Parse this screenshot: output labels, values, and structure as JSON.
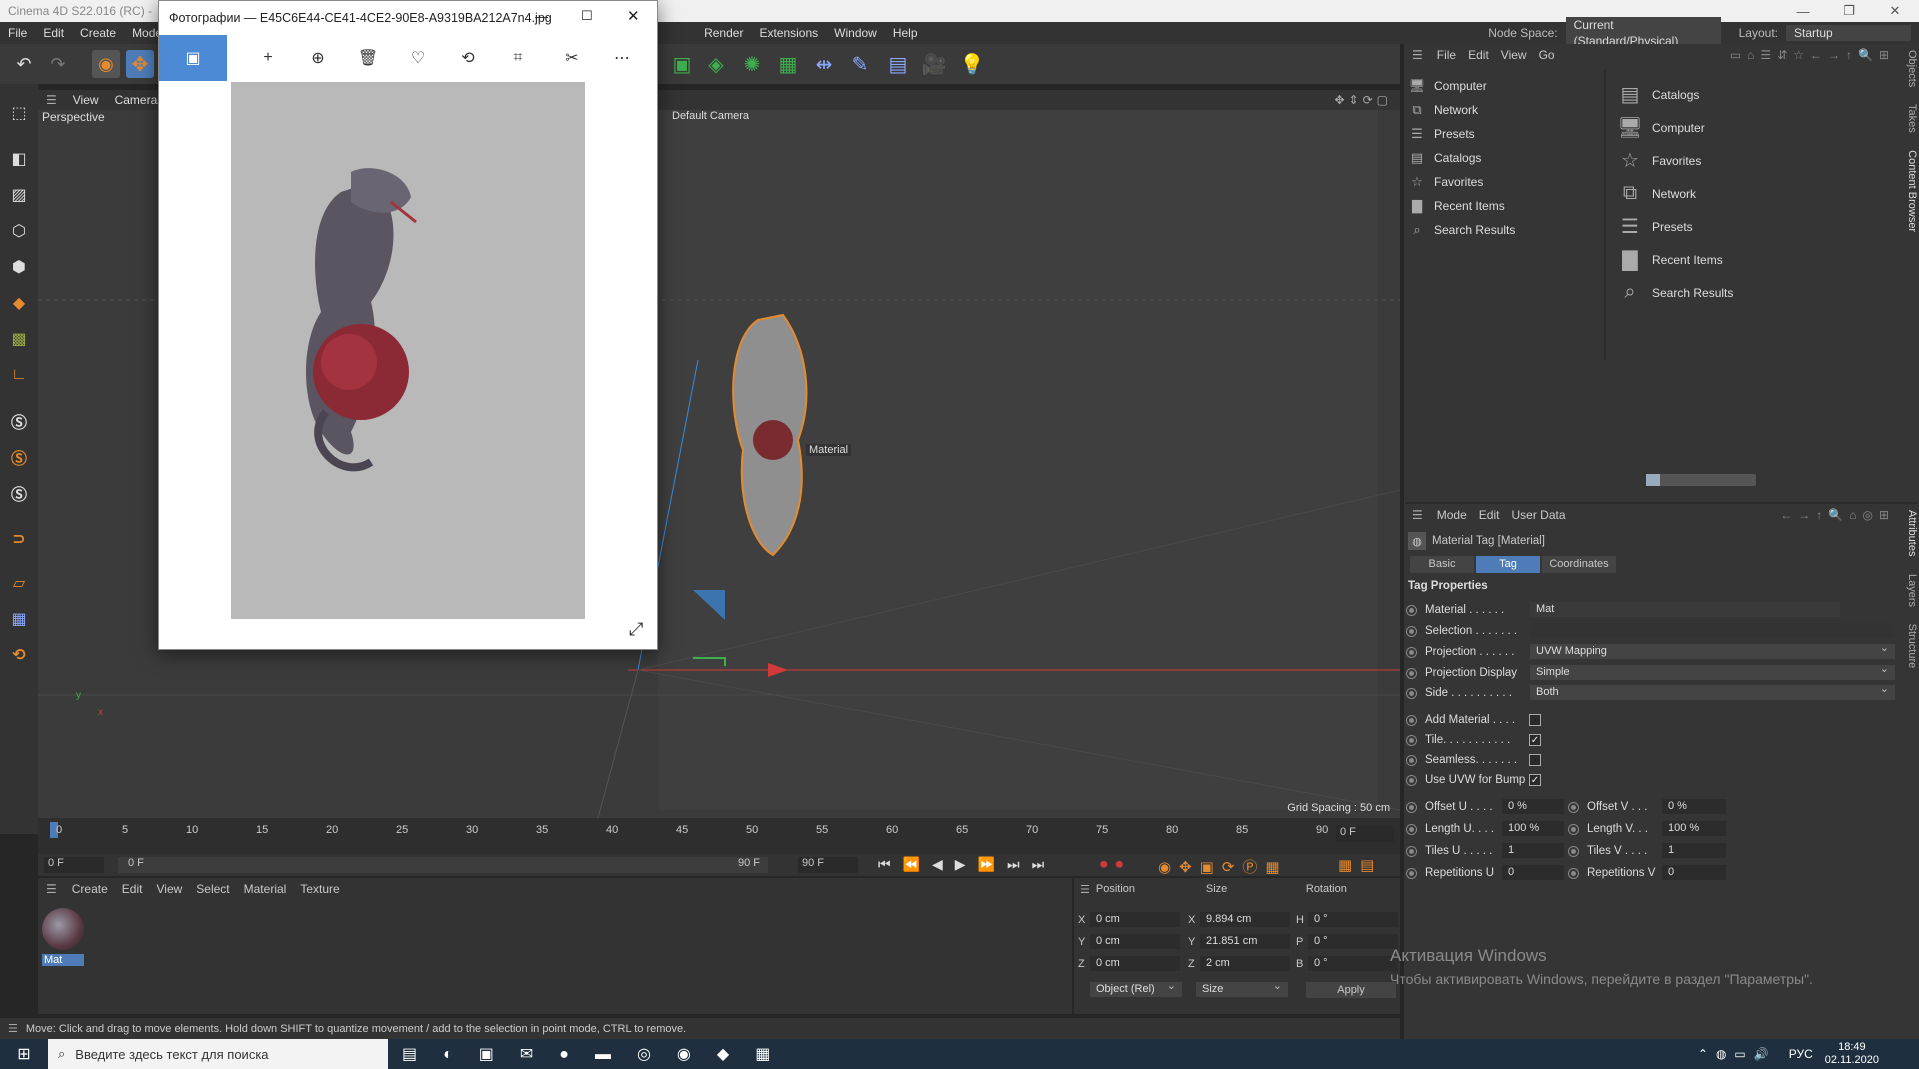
{
  "app": {
    "title": "Cinema 4D S22.016 (RC) -",
    "node_space_label": "Node Space:",
    "node_space_value": "Current (Standard/Physical)",
    "layout_label": "Layout:",
    "layout_value": "Startup"
  },
  "menu": [
    "File",
    "Edit",
    "Create",
    "Modes",
    "Render",
    "Extensions",
    "Window",
    "Help"
  ],
  "viewport": {
    "menu": [
      "View",
      "Cameras"
    ],
    "left_label": "Perspective",
    "camera": "Default Camera",
    "grid_spacing": "Grid Spacing : 50 cm",
    "material_label": "Material"
  },
  "content_browser": {
    "menu": [
      "File",
      "Edit",
      "View",
      "Go"
    ],
    "tree": [
      "Computer",
      "Network",
      "Presets",
      "Catalogs",
      "Favorites",
      "Recent Items",
      "Search Results"
    ],
    "list": [
      "Catalogs",
      "Computer",
      "Favorites",
      "Network",
      "Presets",
      "Recent Items",
      "Search Results"
    ],
    "side_tabs": [
      "Objects",
      "Takes",
      "Content Browser"
    ]
  },
  "attributes": {
    "menu": [
      "Mode",
      "Edit",
      "User Data"
    ],
    "title": "Material Tag [Material]",
    "tabs": [
      "Basic",
      "Tag",
      "Coordinates"
    ],
    "active_tab": "Tag",
    "section": "Tag Properties",
    "material_label": "Material . . . . . .",
    "material_value": "Mat",
    "selection_label": "Selection . . . . . . .",
    "projection_label": "Projection . . . . . .",
    "projection_value": "UVW Mapping",
    "projection_display_label": "Projection Display",
    "projection_display_value": "Simple",
    "side_label": "Side . . . . . . . . . .",
    "side_value": "Both",
    "add_material_label": "Add Material . . . .",
    "tile_label": "Tile. . . . . . . . . . .",
    "seamless_label": "Seamless. . . . . . .",
    "use_uvw_label": "Use UVW for Bump",
    "offset_u_label": "Offset U . . . .",
    "offset_u": "0 %",
    "offset_v_label": "Offset V . . .",
    "offset_v": "0 %",
    "length_u_label": "Length U. . . .",
    "length_u": "100 %",
    "length_v_label": "Length V. . .",
    "length_v": "100 %",
    "tiles_u_label": "Tiles U . . . . .",
    "tiles_u": "1",
    "tiles_v_label": "Tiles V . . . .",
    "tiles_v": "1",
    "rep_u_label": "Repetitions U",
    "rep_u": "0",
    "rep_v_label": "Repetitions V",
    "rep_v": "0",
    "side_tabs": [
      "Attributes",
      "Layers",
      "Structure"
    ]
  },
  "timeline": {
    "ticks": [
      "0",
      "5",
      "10",
      "15",
      "20",
      "25",
      "30",
      "35",
      "40",
      "45",
      "50",
      "55",
      "60",
      "65",
      "70",
      "75",
      "80",
      "85",
      "90"
    ],
    "current": "0 F",
    "start": "0 F",
    "cursor_label": "0 F",
    "end": "90 F",
    "end2": "90 F",
    "right_frame": "0 F"
  },
  "materials": {
    "menu": [
      "Create",
      "Edit",
      "View",
      "Select",
      "Material",
      "Texture"
    ],
    "item": "Mat"
  },
  "coords": {
    "headers": [
      "Position",
      "Size",
      "Rotation"
    ],
    "rows": [
      {
        "axis": "X",
        "pos": "0 cm",
        "size_axis": "X",
        "size": "9.894 cm",
        "rot_axis": "H",
        "rot": "0 °"
      },
      {
        "axis": "Y",
        "pos": "0 cm",
        "size_axis": "Y",
        "size": "21.851 cm",
        "rot_axis": "P",
        "rot": "0 °"
      },
      {
        "axis": "Z",
        "pos": "0 cm",
        "size_axis": "Z",
        "size": "2 cm",
        "rot_axis": "B",
        "rot": "0 °"
      }
    ],
    "mode": "Object (Rel)",
    "size_mode": "Size",
    "apply": "Apply"
  },
  "status": "Move: Click and drag to move elements. Hold down SHIFT to quantize movement / add to the selection in point mode, CTRL to remove.",
  "watermark": {
    "line1": "Активация Windows",
    "line2": "Чтобы активировать Windows, перейдите в раздел \"Параметры\"."
  },
  "taskbar": {
    "search": "Введите здесь текст для поиска",
    "lang": "РУС",
    "time": "18:49",
    "date": "02.11.2020"
  },
  "photos": {
    "title": "Фотографии — E45C6E44-CE41-4CE2-90E8-A9319BA212A7n4.jpg"
  },
  "colors": {
    "accent": "#4d7cb8",
    "orange": "#e48a2f",
    "axis_red": "#d23a3a",
    "axis_green": "#3fae4f",
    "axis_blue": "#3a8be0"
  }
}
